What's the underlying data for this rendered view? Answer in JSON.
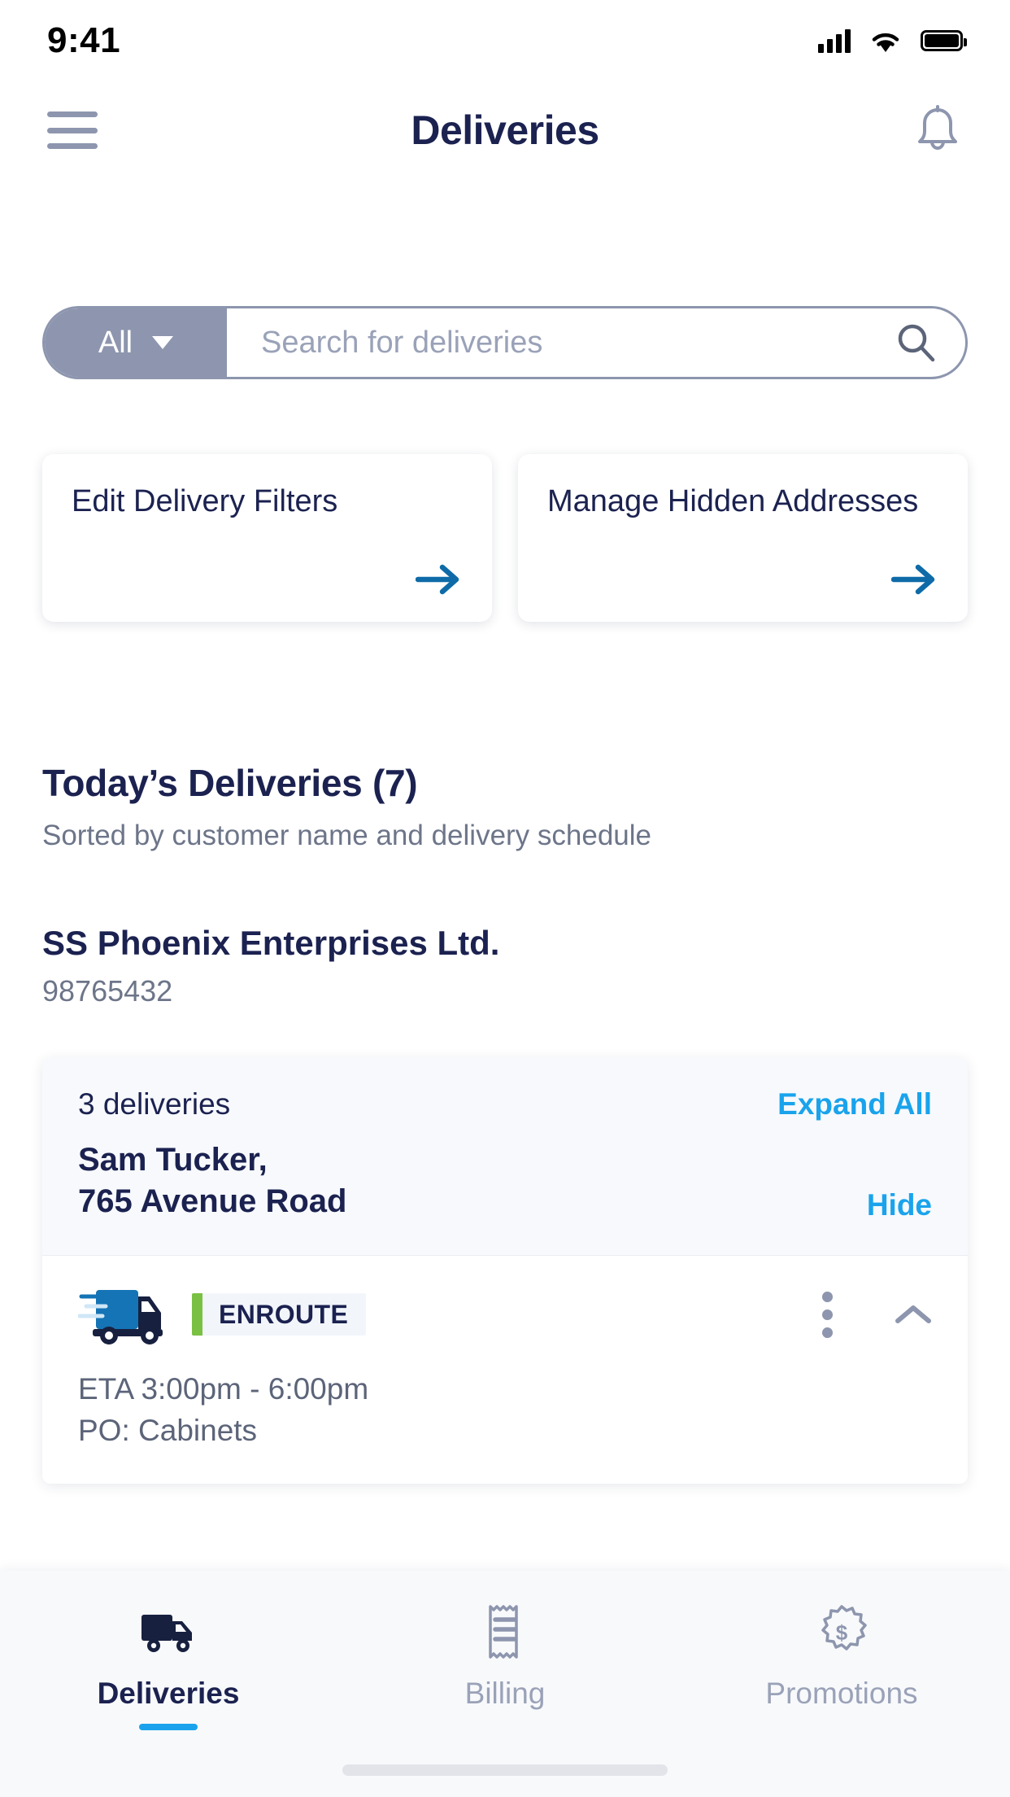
{
  "status_bar": {
    "time": "9:41",
    "signal_icon": "cellular-signal-icon",
    "wifi_icon": "wifi-icon",
    "battery_icon": "battery-icon"
  },
  "app_bar": {
    "menu_icon": "hamburger-menu-icon",
    "title": "Deliveries",
    "notification_icon": "bell-icon"
  },
  "search": {
    "scope_label": "All",
    "scope_chevron": "chevron-down-icon",
    "placeholder": "Search for deliveries",
    "search_icon": "magnifier-icon"
  },
  "action_cards": [
    {
      "title": "Edit Delivery Filters",
      "arrow_icon": "arrow-right-icon"
    },
    {
      "title": "Manage Hidden Addresses",
      "arrow_icon": "arrow-right-icon"
    }
  ],
  "section": {
    "title": "Today’s Deliveries (7)",
    "subtitle": "Sorted by customer name and delivery schedule"
  },
  "customer": {
    "name": "SS Phoenix Enterprises Ltd.",
    "account_number": "98765432"
  },
  "delivery_group": {
    "count_label": "3 deliveries",
    "expand_all_label": "Expand All",
    "address_line1": "Sam Tucker,",
    "address_line2": "765 Avenue Road",
    "hide_label": "Hide",
    "deliveries": [
      {
        "truck_icon": "delivery-truck-icon",
        "status": "ENROUTE",
        "status_color": "#7ac143",
        "more_icon": "kebab-menu-icon",
        "collapse_icon": "chevron-up-icon",
        "eta": "ETA 3:00pm - 6:00pm",
        "po": "PO: Cabinets"
      }
    ]
  },
  "bottom_nav": {
    "items": [
      {
        "label": "Deliveries",
        "icon": "truck-icon",
        "active": true
      },
      {
        "label": "Billing",
        "icon": "receipt-icon",
        "active": false
      },
      {
        "label": "Promotions",
        "icon": "dollar-badge-icon",
        "active": false
      }
    ],
    "active_indicator_color": "#1aa3ec"
  },
  "colors": {
    "primary_navy": "#1b2250",
    "accent_blue": "#1aa3ec",
    "link_blue": "#0e6ba8",
    "muted_gray": "#8d96ae",
    "status_green": "#7ac143"
  }
}
